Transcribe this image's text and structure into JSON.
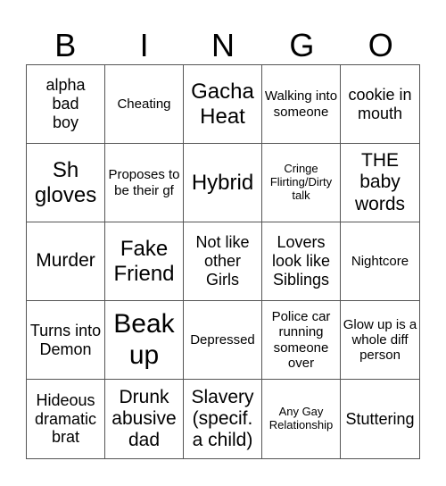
{
  "header": {
    "letters": [
      "B",
      "I",
      "N",
      "G",
      "O"
    ]
  },
  "cells": [
    [
      "alpha bad boy",
      "Cheating",
      "Gacha Heat",
      "Walking into someone",
      "cookie in mouth"
    ],
    [
      "Sh gloves",
      "Proposes to be their gf",
      "Hybrid",
      "Cringe Flirting/Dirty talk",
      "THE baby words"
    ],
    [
      "Murder",
      "Fake Friend",
      "Not like other Girls",
      "Lovers look like Siblings",
      "Nightcore"
    ],
    [
      "Turns into Demon",
      "Beak up",
      "Depressed",
      "Police car running someone over",
      "Glow up is a whole diff person"
    ],
    [
      "Hideous dramatic brat",
      "Drunk abusive dad",
      "Slavery (specif. a child)",
      "Any Gay Relationship",
      "Stuttering"
    ]
  ]
}
